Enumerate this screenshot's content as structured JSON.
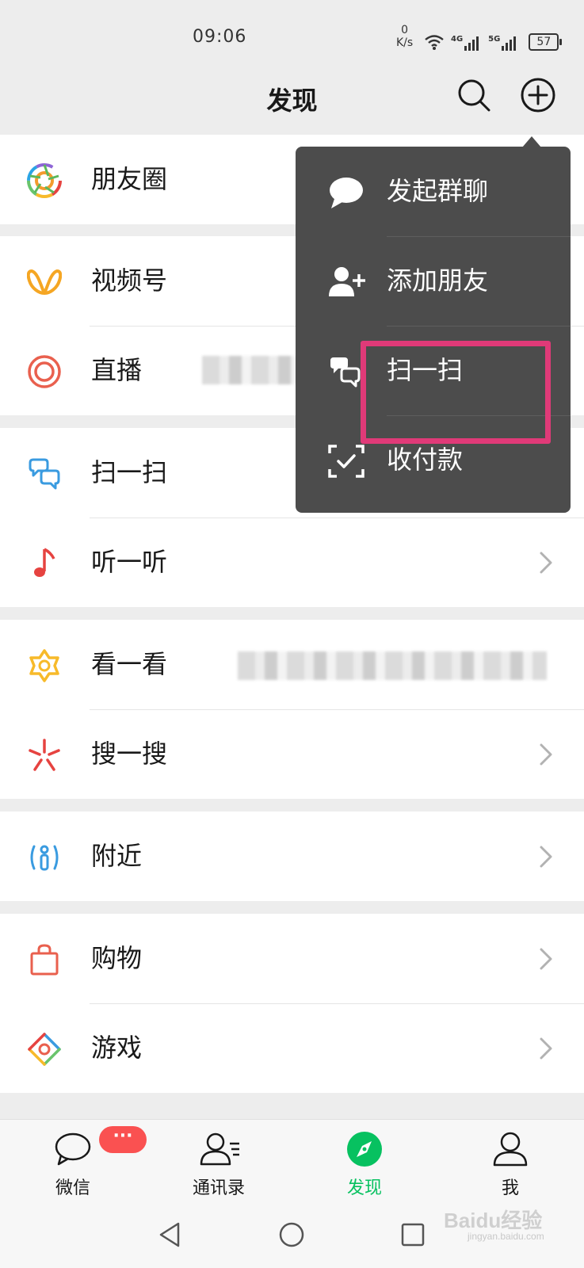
{
  "status_bar": {
    "time": "09:06",
    "speed_value": "0",
    "speed_unit": "K/s",
    "net1": "4G",
    "net2": "5G",
    "battery": "57"
  },
  "header": {
    "title": "发现",
    "search_icon": "search-icon",
    "plus_icon": "plus-circle-icon"
  },
  "list": {
    "moments": "朋友圈",
    "channels": "视频号",
    "live": "直播",
    "scan": "扫一扫",
    "listen": "听一听",
    "top_stories": "看一看",
    "search": "搜一搜",
    "nearby": "附近",
    "shopping": "购物",
    "games": "游戏"
  },
  "popup_menu": {
    "items": [
      {
        "label": "发起群聊",
        "icon": "chat-bubble-icon"
      },
      {
        "label": "添加朋友",
        "icon": "add-friend-icon"
      },
      {
        "label": "扫一扫",
        "icon": "scan-icon"
      },
      {
        "label": "收付款",
        "icon": "payment-icon"
      }
    ],
    "highlight_color": "#e03a78"
  },
  "tabbar": {
    "chats": "微信",
    "chats_badge": "···",
    "contacts": "通讯录",
    "discover": "发现",
    "me": "我",
    "active_color": "#07c160"
  },
  "watermark": {
    "brand": "Baidu经验",
    "url": "jingyan.baidu.com"
  }
}
